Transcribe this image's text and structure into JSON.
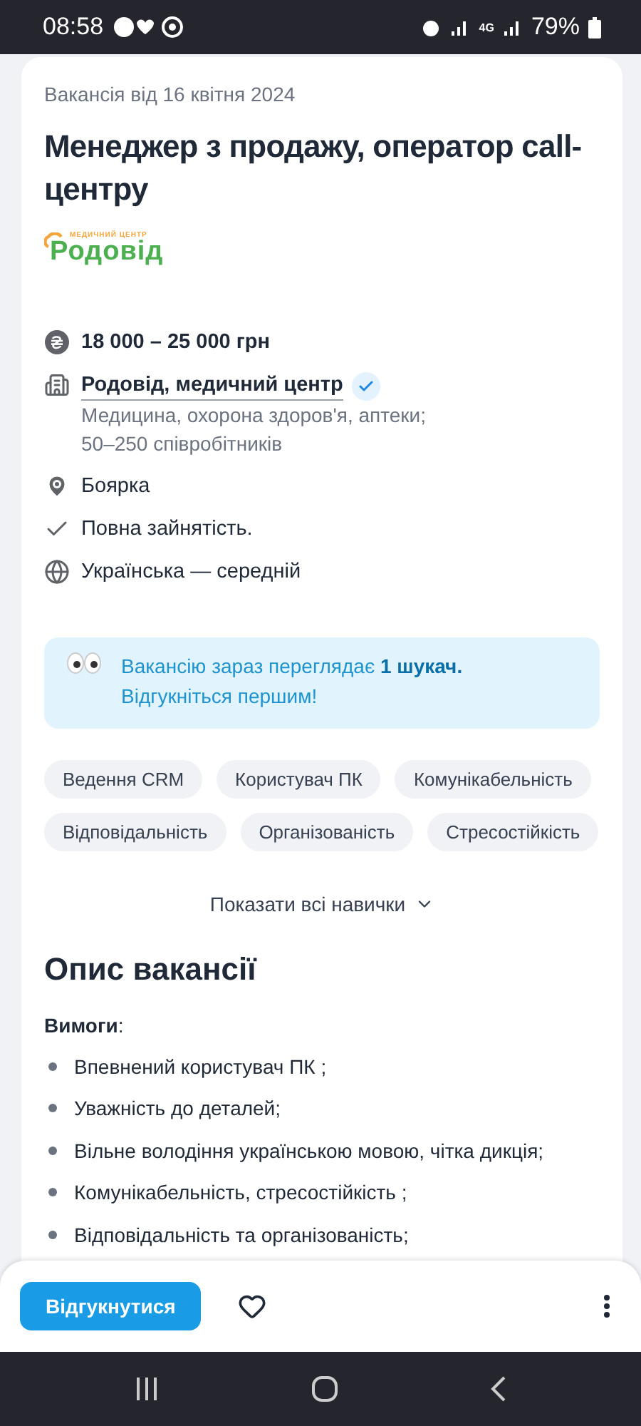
{
  "status_bar": {
    "time": "08:58",
    "network": "4G",
    "battery": "79%"
  },
  "vacancy": {
    "date": "Вакансія від 16 квітня 2024",
    "title": "Менеджер з продажу, оператор call-центру",
    "logo": {
      "tagline": "МЕДИЧНИЙ ЦЕНТР",
      "name": "Родовід"
    },
    "details": [
      {
        "kind": "salary",
        "text": "18 000 – 25 000 грн"
      },
      {
        "kind": "company",
        "text": "Родовід, медичний центр",
        "verified": true,
        "lines": [
          "Медицина, охорона здоров'я, аптеки;",
          "50–250 співробітників"
        ]
      },
      {
        "kind": "location",
        "text": "Боярка"
      },
      {
        "kind": "employment",
        "text": "Повна зайнятість."
      },
      {
        "kind": "language",
        "text": "Українська — середній"
      }
    ],
    "banner": "Вакансію зараз переглядає **1 шукач.**\nВідгукніться першим!",
    "skills": [
      "Ведення CRM",
      "Користувач ПК",
      "Комунікабельність",
      "Відповідальність",
      "Організованість",
      "Стресостійкість"
    ],
    "show_all": "Показати всі навички",
    "description": {
      "heading": "Опис вакансії",
      "subheading": "**Вимоги**:",
      "bullets": [
        "Впевнений користувач ПК ;",
        "Уважність до деталей;",
        "Вільне володіння українською мовою, чітка дикція;",
        "Комунікабельність, стресостійкість ;",
        "Відповідальність та організованість;"
      ]
    }
  },
  "actions": {
    "apply": "Відгукнутися",
    "saved": false
  }
}
